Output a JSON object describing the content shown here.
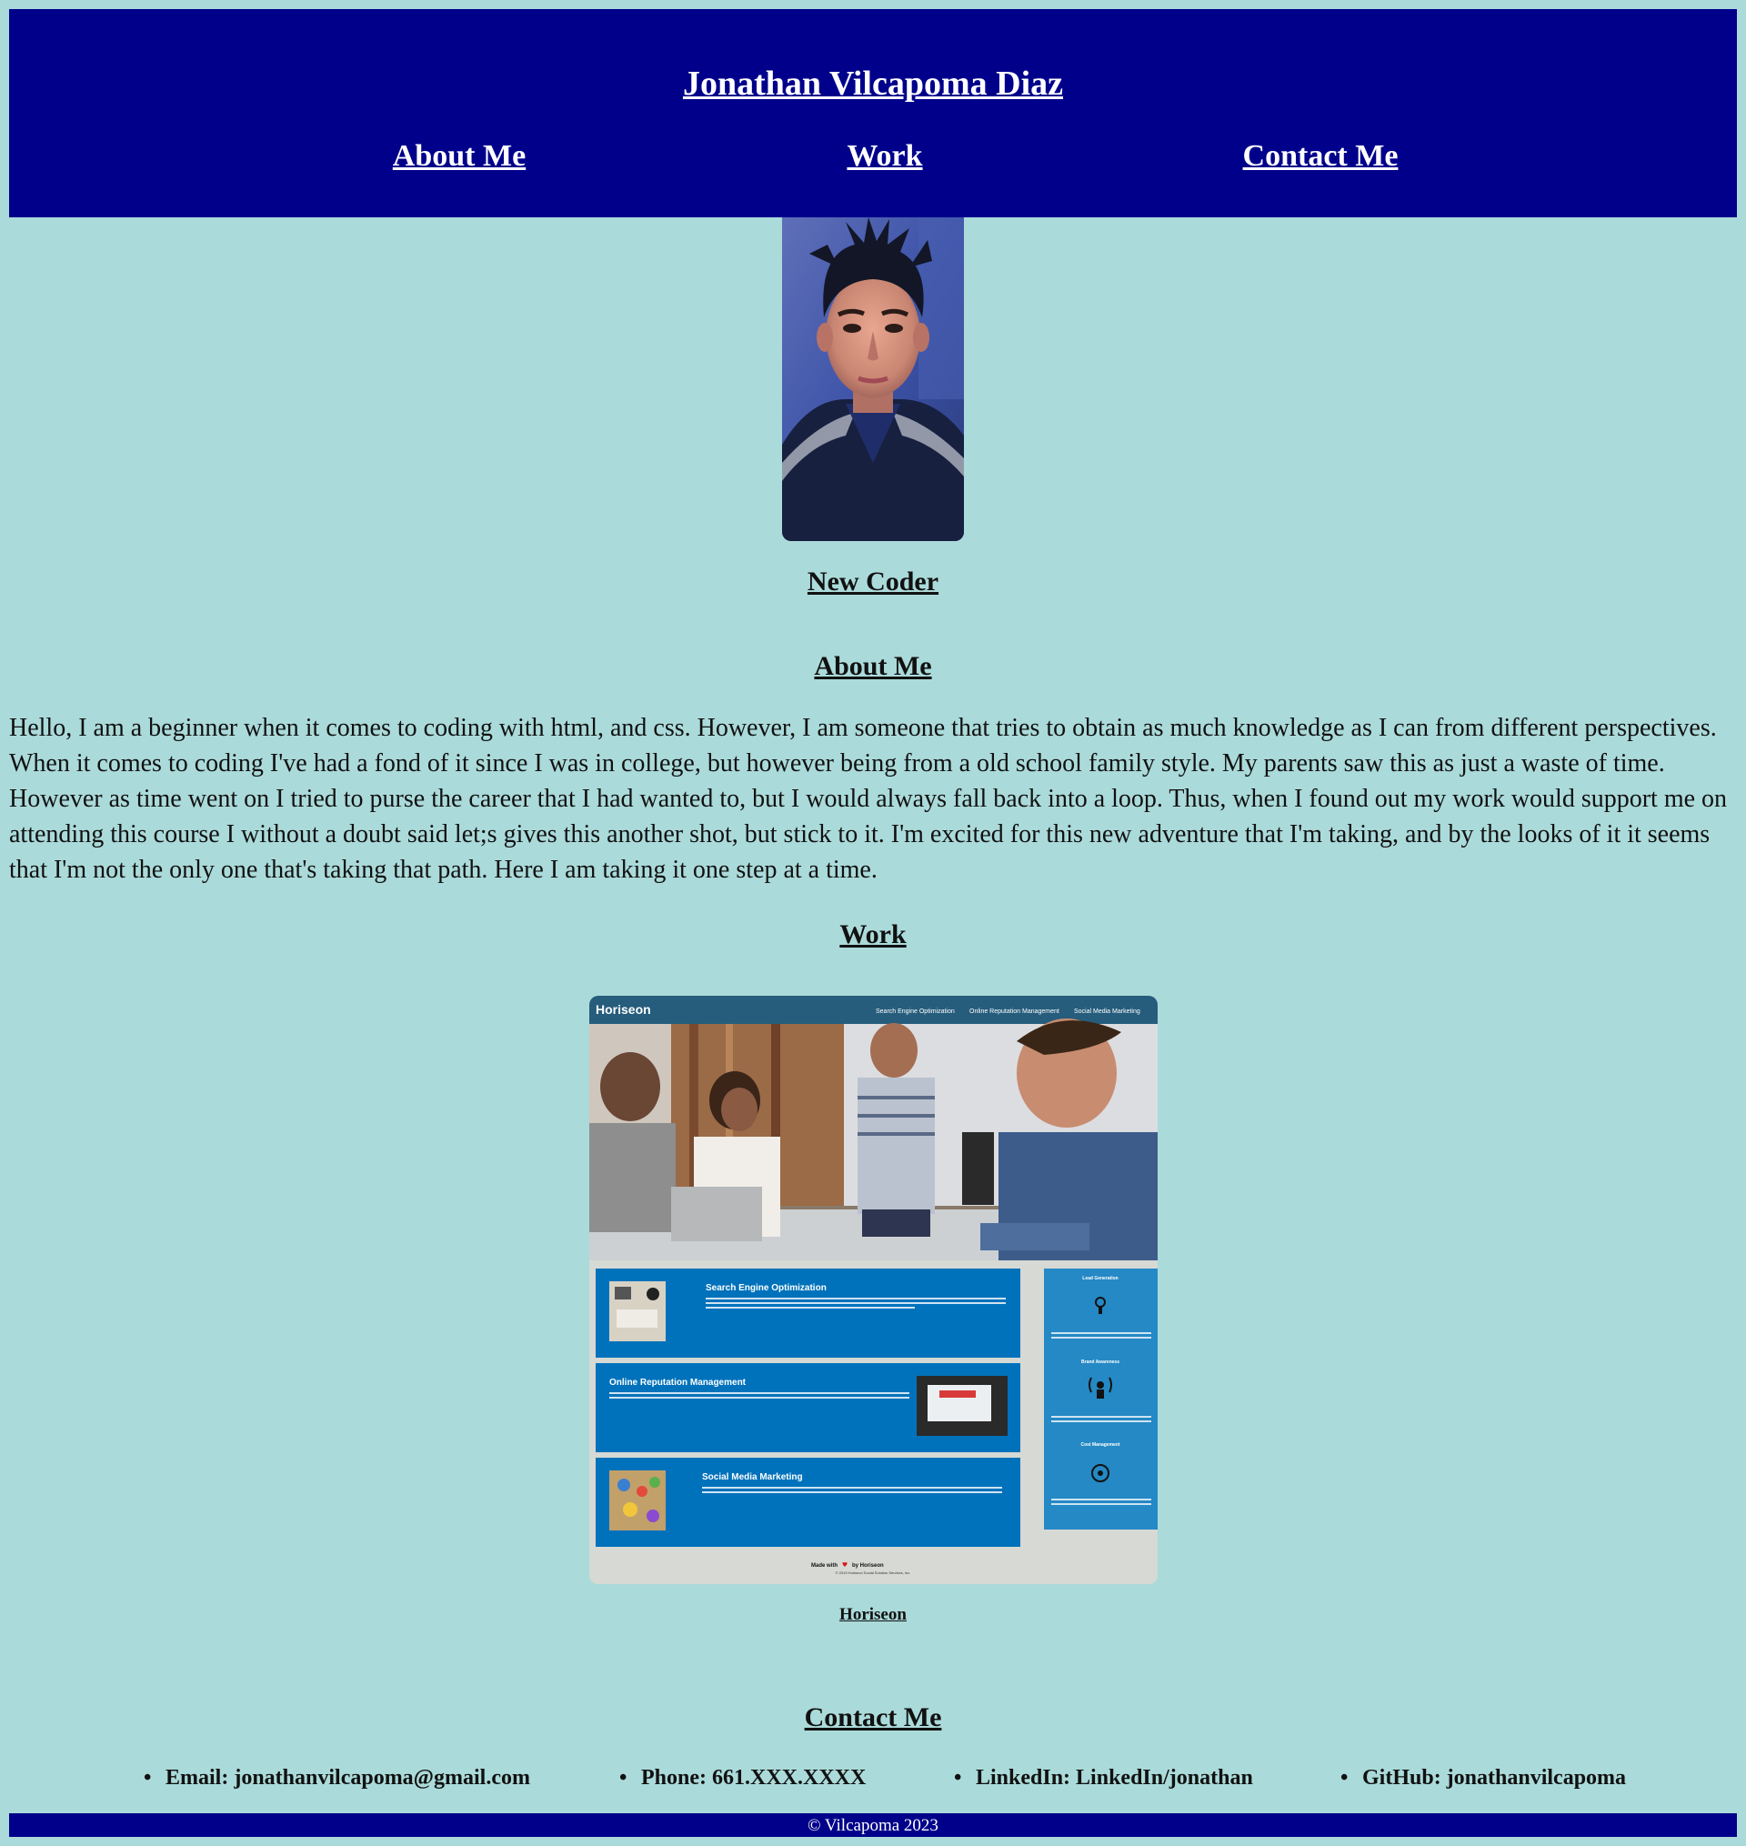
{
  "header": {
    "title": "Jonathan Vilcapoma Diaz",
    "nav": [
      "About Me",
      "Work",
      "Contact Me"
    ]
  },
  "profile": {
    "subtitle": "New Coder"
  },
  "about": {
    "heading": "About Me",
    "text": "Hello, I am a beginner when it comes to coding with html, and css. However, I am someone that tries to obtain as much knowledge as I can from different perspectives. When it comes to coding I've had a fond of it since I was in college, but however being from a old school family style. My parents saw this as just a waste of time. However as time went on I tried to purse the career that I had wanted to, but I would always fall back into a loop. Thus, when I found out my work would support me on attending this course I without a doubt said let;s gives this another shot, but stick to it. I'm excited for this new adventure that I'm taking, and by the looks of it it seems that I'm not the only one that's taking that path. Here I am taking it one step at a time."
  },
  "work": {
    "heading": "Work",
    "caption": "Horiseon",
    "screenshot": {
      "brand": "Horiseon",
      "nav": [
        "Search Engine Optimization",
        "Online Reputation Management",
        "Social Media Marketing"
      ],
      "cards": [
        {
          "title": "Search Engine Optimization",
          "text": "The dominance of mobile internet use means that users are searching for the right business on their small, drop-in-the-machine Search Engine Optimization (SEO) allows you to increase your visibility and find the right customers for your business."
        },
        {
          "title": "Online Reputation Management",
          "text": "The web is full of opinions, and some of them are not negative. Social media allows anyone with an internet connection to see whatever they want about your business. Online Reputation Management gives you the control over what potential customers see when they search for your business."
        },
        {
          "title": "Social Media Marketing",
          "text": "Social media continues to have a sizable influence on buying habits. Social media marketing helps you determine which platforms are suited to your brand, using analytics to find the right markets and increase your lead generation."
        }
      ],
      "sidebar": [
        {
          "title": "Lead Generation",
          "text": "A focused strategy for lead generation ensures that your customers reach your business, bringing consumers directly to your website."
        },
        {
          "title": "Brand Awareness",
          "text": "Users find your business through paid and organic searches, increasing the search ranking and visibility for your business."
        },
        {
          "title": "Cost Management",
          "text": "As the search ranking for your business increases, your advertising costs decrease, and you no longer need to submit for your page."
        }
      ],
      "footer_made": "Made with",
      "footer_by": "by Horiseon",
      "footer_copy": "© 2019 Horiseon Social Solution Services, Inc."
    }
  },
  "contact": {
    "heading": "Contact Me",
    "items": [
      "Email: jonathanvilcapoma@gmail.com",
      "Phone: 661.XXX.XXXX",
      "LinkedIn: LinkedIn/jonathan",
      "GitHub: jonathanvilcapoma"
    ]
  },
  "footer": {
    "text": "© Vilcapoma 2023"
  },
  "colors": {
    "background": "#abdada",
    "header": "#00008b",
    "screenshot_header": "#265d7c",
    "screenshot_card": "#0072bb",
    "screenshot_sidebar": "#2489c5"
  }
}
